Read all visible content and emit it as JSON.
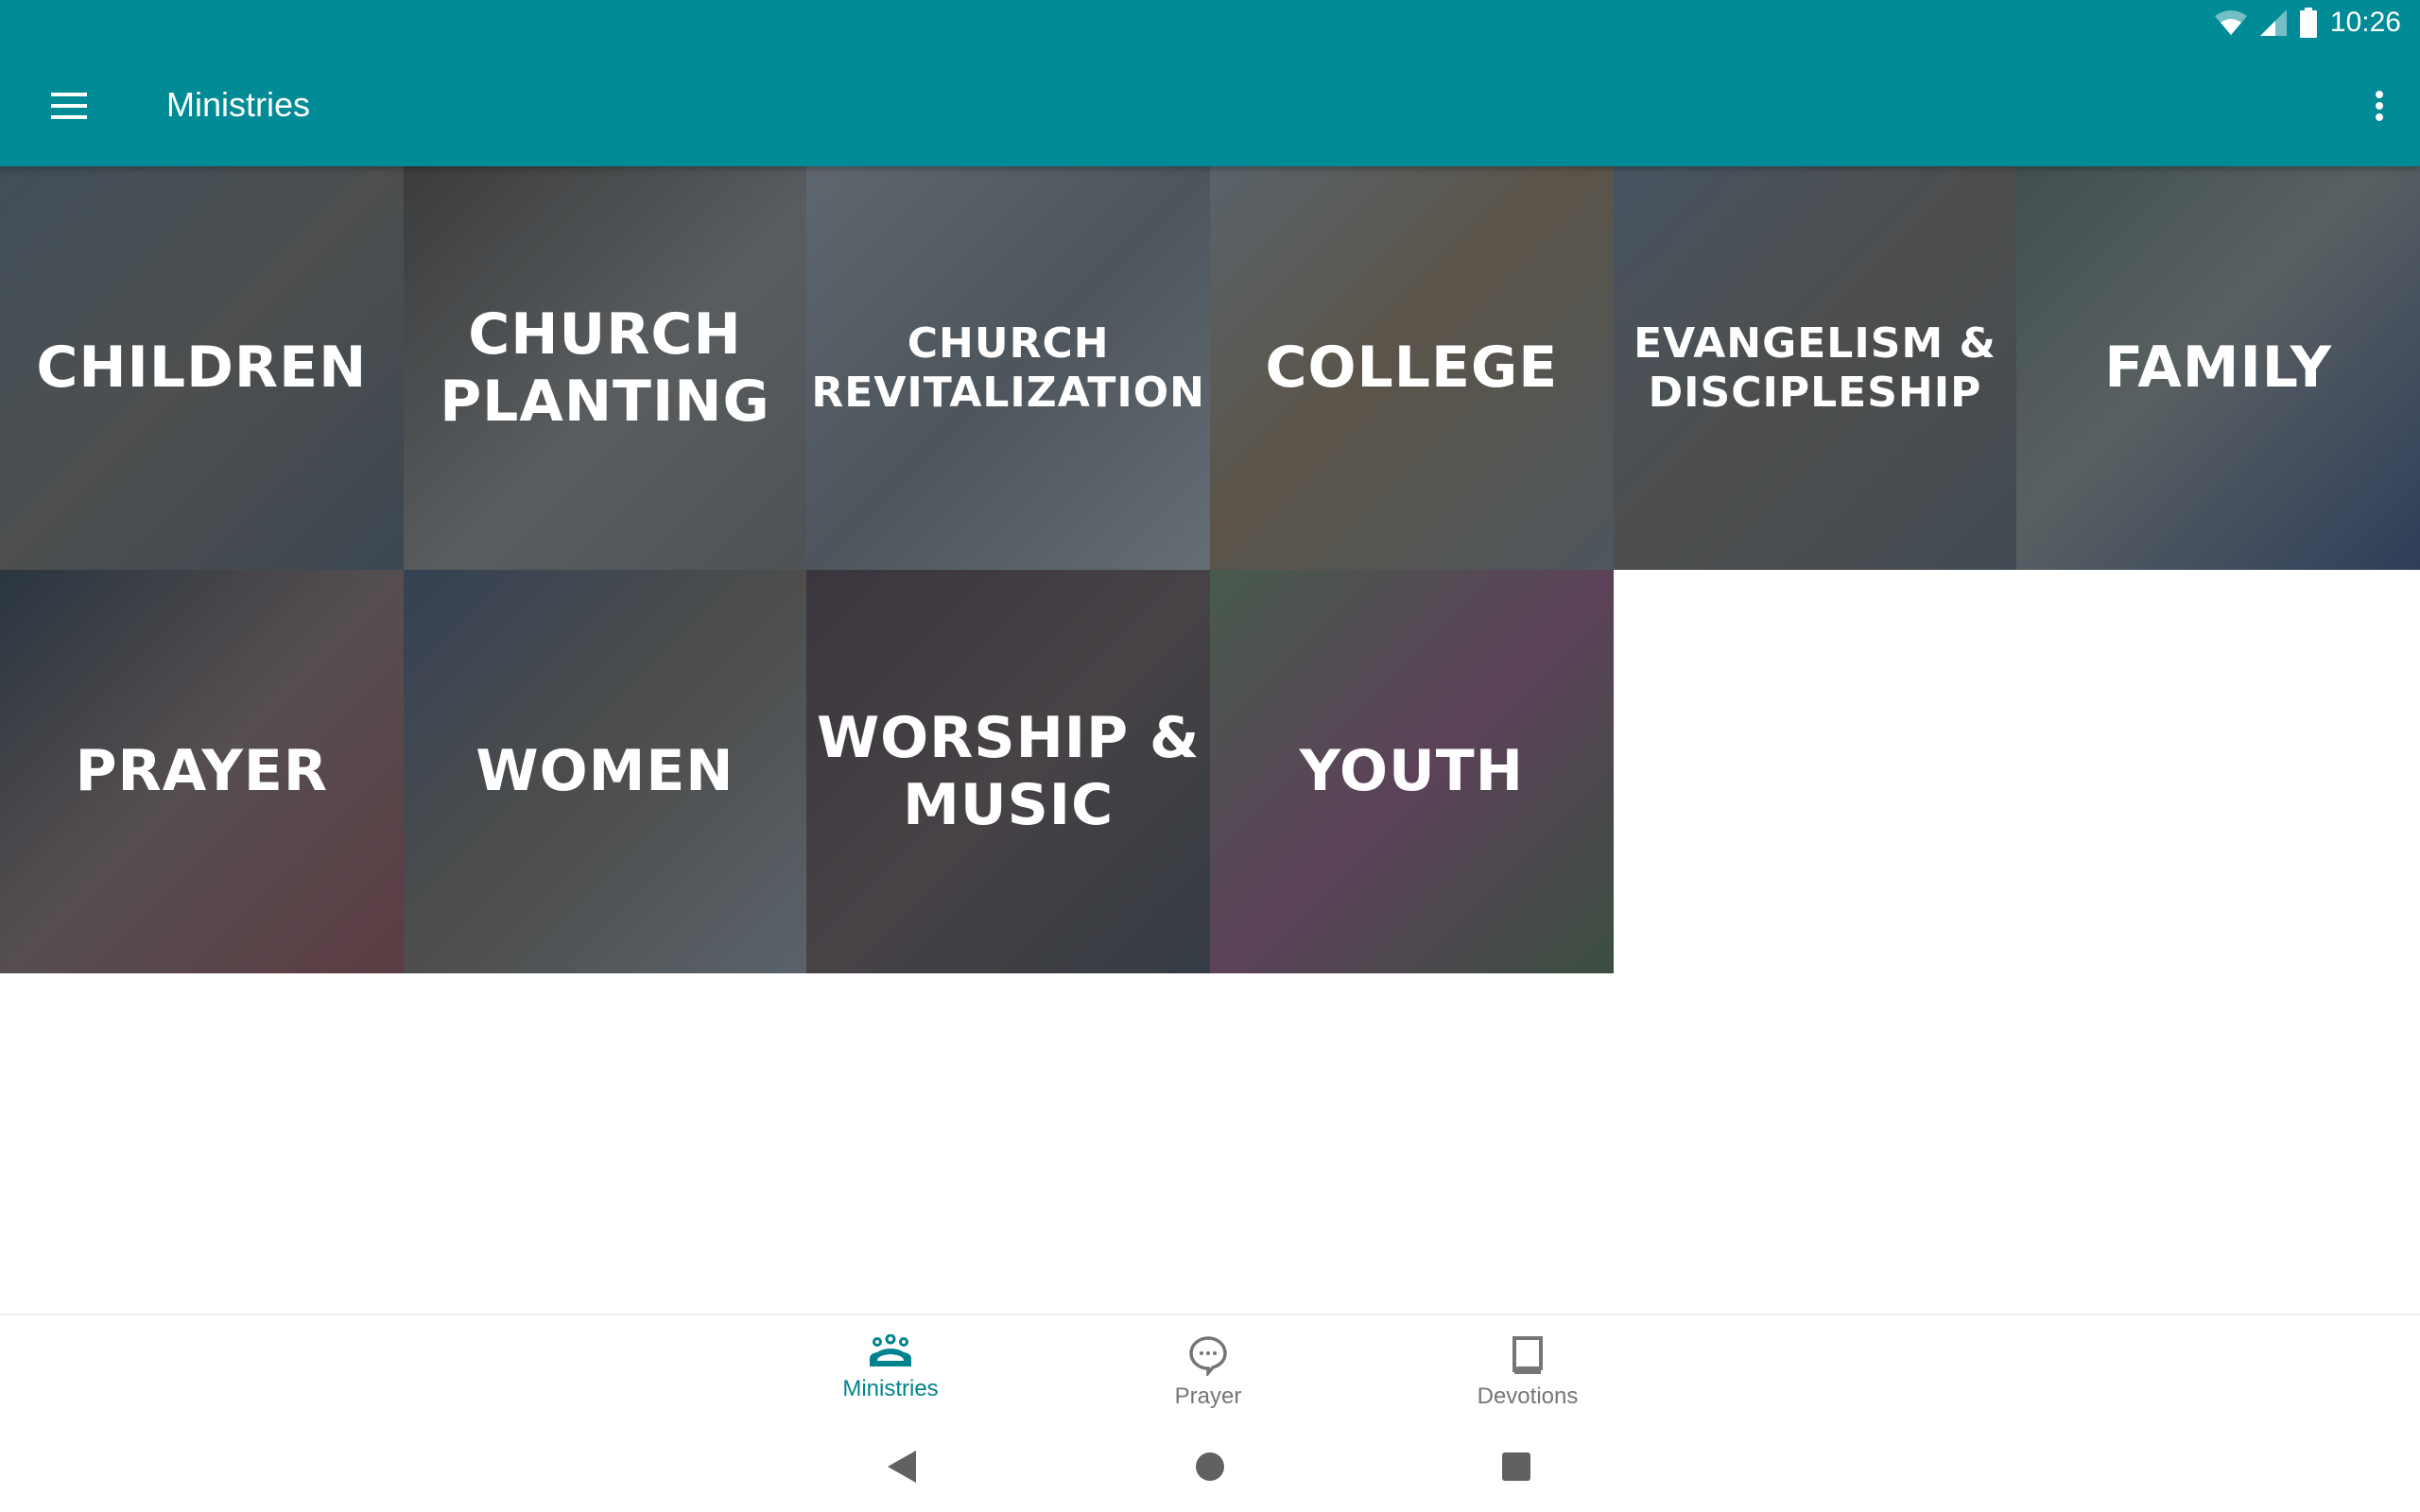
{
  "status_bar": {
    "time": "10:26",
    "icons": [
      "wifi-icon",
      "cell-signal-icon",
      "battery-icon"
    ]
  },
  "toolbar": {
    "title": "Ministries",
    "menu_icon": "hamburger-menu-icon",
    "more_icon": "more-vert-icon"
  },
  "colors": {
    "primary": "#008b96",
    "nav_active": "#00838f",
    "nav_inactive": "#757575"
  },
  "tiles": [
    {
      "label": "CHILDREN"
    },
    {
      "label": "CHURCH\nPLANTING"
    },
    {
      "label": "CHURCH\nREVITALIZATION"
    },
    {
      "label": "COLLEGE"
    },
    {
      "label": "EVANGELISM &\nDISCIPLESHIP"
    },
    {
      "label": "FAMILY"
    },
    {
      "label": "PRAYER"
    },
    {
      "label": "WOMEN"
    },
    {
      "label": "WORSHIP &\nMUSIC"
    },
    {
      "label": "YOUTH"
    }
  ],
  "bottom_nav": {
    "items": [
      {
        "label": "Ministries",
        "icon": "groups-icon",
        "active": true
      },
      {
        "label": "Prayer",
        "icon": "chat-bubble-icon",
        "active": false
      },
      {
        "label": "Devotions",
        "icon": "book-icon",
        "active": false
      }
    ]
  },
  "system_nav": {
    "buttons": [
      "back",
      "home",
      "recents"
    ]
  }
}
